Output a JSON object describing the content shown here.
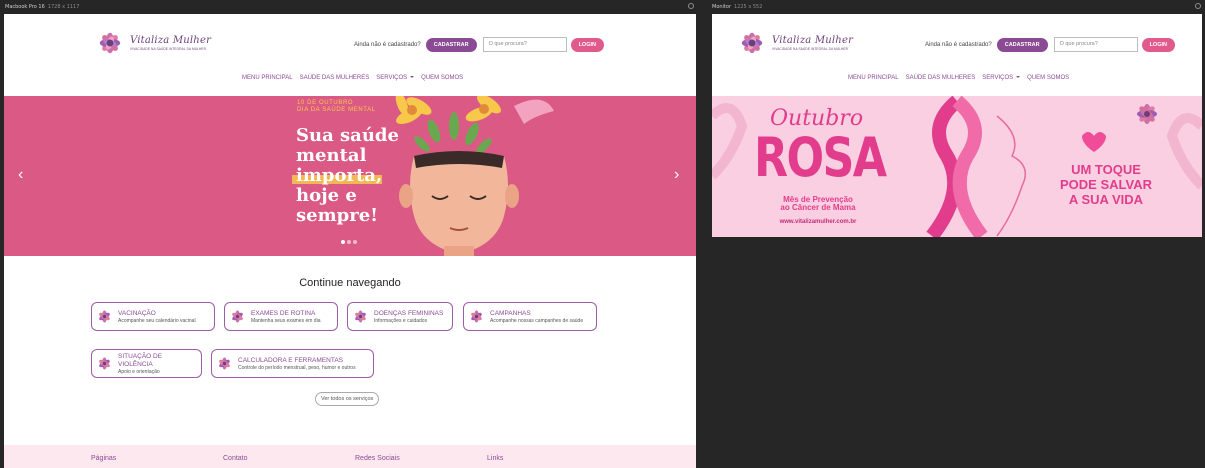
{
  "frames": {
    "mac": {
      "label": "Macbook Pro 16",
      "dims": "1728 x 1117"
    },
    "monitor": {
      "label": "Monitor",
      "dims": "1225 x 552"
    }
  },
  "brand": {
    "name": "Vitaliza Mulher",
    "tagline": "VIVACIDADE NA SAÚDE INTEGRAL DA MULHER"
  },
  "header": {
    "question": "Ainda não é cadastrado?",
    "register_label": "CADASTRAR",
    "search_placeholder": "O que procura?",
    "login_label": "LOGIN"
  },
  "nav": [
    "MENU PRINCIPAL",
    "SAÚDE DAS MULHERES",
    "SERVIÇOS",
    "QUEM SOMOS"
  ],
  "hero": {
    "date_line1": "10 DE OUTUBRO",
    "date_line2": "DIA DA SAÚDE MENTAL",
    "headline_1": "Sua saúde",
    "headline_2": "mental",
    "headline_3": "importa,",
    "headline_4": "hoje e",
    "headline_5": "sempre!",
    "prev": "‹",
    "next": "›",
    "colors": {
      "bg": "#db5a85",
      "accent": "#f7c84a"
    }
  },
  "section_title": "Continue navegando",
  "cards": [
    {
      "title": "VACINAÇÃO",
      "desc": "Acompanhe seu calendário vacinal"
    },
    {
      "title": "EXAMES DE ROTINA",
      "desc": "Mantenha seus exames em dia"
    },
    {
      "title": "DOENÇAS FEMININAS",
      "desc": "Informações e cuidados"
    },
    {
      "title": "CAMPANHAS",
      "desc": "Acompanhe nossas campanhes de saúde"
    },
    {
      "title": "SITUAÇÃO DE VIOLÊNCIA",
      "desc": "Apoio e orientação"
    },
    {
      "title": "CALCULADORA E FERRAMENTAS",
      "desc": "Controle do período menstrual, peso, humor e outros"
    }
  ],
  "view_all": "Ver todos os serviços",
  "footer": [
    "Páginas",
    "Contato",
    "Redes Sociais",
    "Links"
  ],
  "banner": {
    "outubro": "Outubro",
    "rosa": "ROSA",
    "mes_line1": "Mês de Prevenção",
    "mes_line2": "ao Câncer de Mama",
    "url": "www.vitalizamulher.com.br",
    "toque_1": "UM TOQUE",
    "toque_2": "PODE SALVAR",
    "toque_3": "A SUA VIDA"
  }
}
